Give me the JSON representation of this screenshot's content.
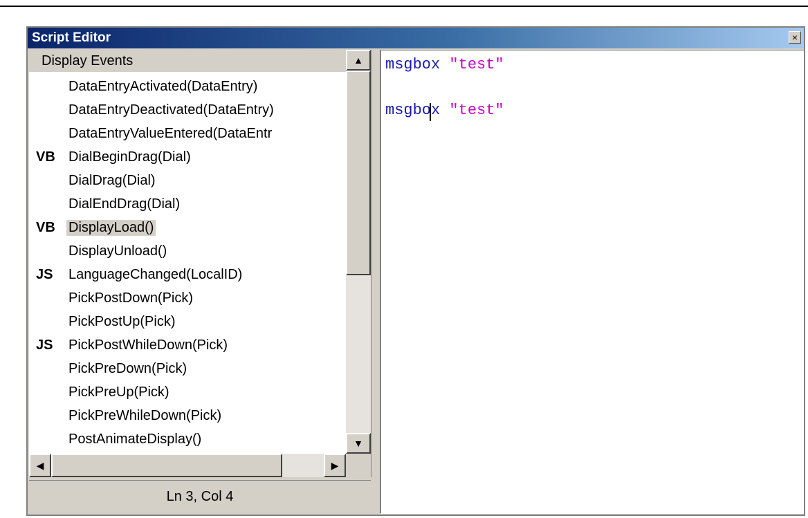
{
  "window": {
    "title": "Script Editor",
    "close_glyph": "×"
  },
  "event_list": {
    "header": "Display Events",
    "items": [
      {
        "prefix": "",
        "label": "DataEntryActivated(DataEntry)",
        "selected": false
      },
      {
        "prefix": "",
        "label": "DataEntryDeactivated(DataEntry)",
        "selected": false
      },
      {
        "prefix": "",
        "label": "DataEntryValueEntered(DataEntr",
        "selected": false
      },
      {
        "prefix": "VB",
        "label": "DialBeginDrag(Dial)",
        "selected": false
      },
      {
        "prefix": "",
        "label": "DialDrag(Dial)",
        "selected": false
      },
      {
        "prefix": "",
        "label": "DialEndDrag(Dial)",
        "selected": false
      },
      {
        "prefix": "VB",
        "label": "DisplayLoad()",
        "selected": true
      },
      {
        "prefix": "",
        "label": "DisplayUnload()",
        "selected": false
      },
      {
        "prefix": "JS",
        "label": "LanguageChanged(LocalID)",
        "selected": false
      },
      {
        "prefix": "",
        "label": "PickPostDown(Pick)",
        "selected": false
      },
      {
        "prefix": "",
        "label": "PickPostUp(Pick)",
        "selected": false
      },
      {
        "prefix": "JS",
        "label": "PickPostWhileDown(Pick)",
        "selected": false
      },
      {
        "prefix": "",
        "label": "PickPreDown(Pick)",
        "selected": false
      },
      {
        "prefix": "",
        "label": "PickPreUp(Pick)",
        "selected": false
      },
      {
        "prefix": "",
        "label": "PickPreWhileDown(Pick)",
        "selected": false
      },
      {
        "prefix": "",
        "label": "PostAnimateDisplay()",
        "selected": false
      }
    ]
  },
  "scrollbars": {
    "up_glyph": "▲",
    "down_glyph": "▼",
    "left_glyph": "◀",
    "right_glyph": "▶"
  },
  "status": {
    "position": "Ln 3, Col 4"
  },
  "editor": {
    "lines": [
      {
        "keyword": "msgbox",
        "string": "\"test\""
      },
      {
        "keyword": "",
        "string": ""
      },
      {
        "keyword": "msgbox",
        "string": "\"test\""
      }
    ]
  },
  "colors": {
    "keyword": "#1a1ab0",
    "string": "#cc00cc",
    "titlebar_start": "#0a246a",
    "titlebar_end": "#a6caf0"
  }
}
